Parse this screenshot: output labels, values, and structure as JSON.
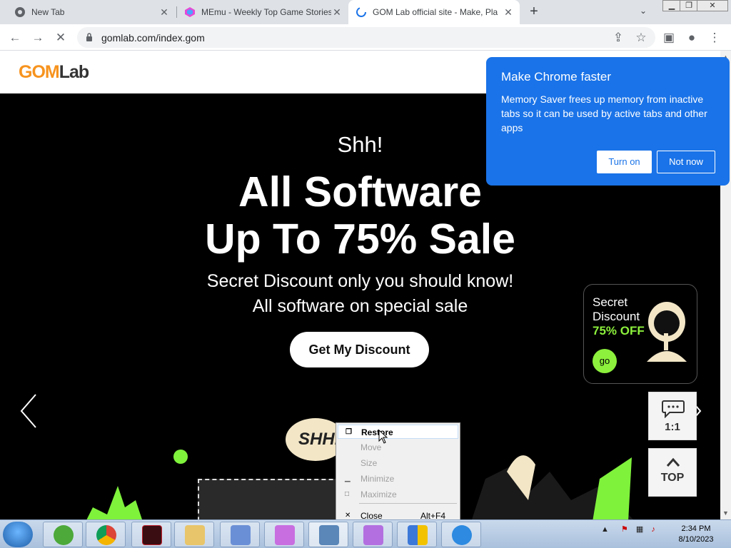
{
  "browser": {
    "tabs": [
      {
        "title": "New Tab",
        "active": false
      },
      {
        "title": "MEmu - Weekly Top Game Stories",
        "active": false
      },
      {
        "title": "GOM Lab official site - Make, Pla",
        "active": true
      }
    ],
    "new_tab_label": "+",
    "url": "gomlab.com/index.gom"
  },
  "site": {
    "logo_main": "GOM",
    "logo_sub": "Lab",
    "hero": {
      "kicker": "Shh!",
      "headline_line1": "All Software",
      "headline_line2": "Up To 75% Sale",
      "sub_line1": "Secret Discount only you should know!",
      "sub_line2": "All software on special sale",
      "cta": "Get My Discount"
    },
    "promo": {
      "line1": "Secret",
      "line2": "Discount",
      "line3": "75% OFF",
      "go": "go"
    },
    "chat_label": "1:1",
    "top_label": "TOP",
    "shh_bubble": "SHH.."
  },
  "chrome_bubble": {
    "title": "Make Chrome faster",
    "message": "Memory Saver frees up memory from inactive tabs so it can be used by active tabs and other apps",
    "turn_on": "Turn on",
    "not_now": "Not now"
  },
  "context_menu": {
    "items": [
      {
        "label": "Restore",
        "enabled": true,
        "accel": ""
      },
      {
        "label": "Move",
        "enabled": false,
        "accel": ""
      },
      {
        "label": "Size",
        "enabled": false,
        "accel": ""
      },
      {
        "label": "Minimize",
        "enabled": false,
        "accel": ""
      },
      {
        "label": "Maximize",
        "enabled": false,
        "accel": ""
      },
      {
        "label": "Close",
        "enabled": true,
        "accel": "Alt+F4"
      }
    ]
  },
  "taskbar": {
    "time": "2:34 PM",
    "date": "8/10/2023"
  },
  "colors": {
    "accent_blue": "#1a73e8",
    "gom_orange": "#f7931e",
    "promo_green": "#8cf03c"
  }
}
